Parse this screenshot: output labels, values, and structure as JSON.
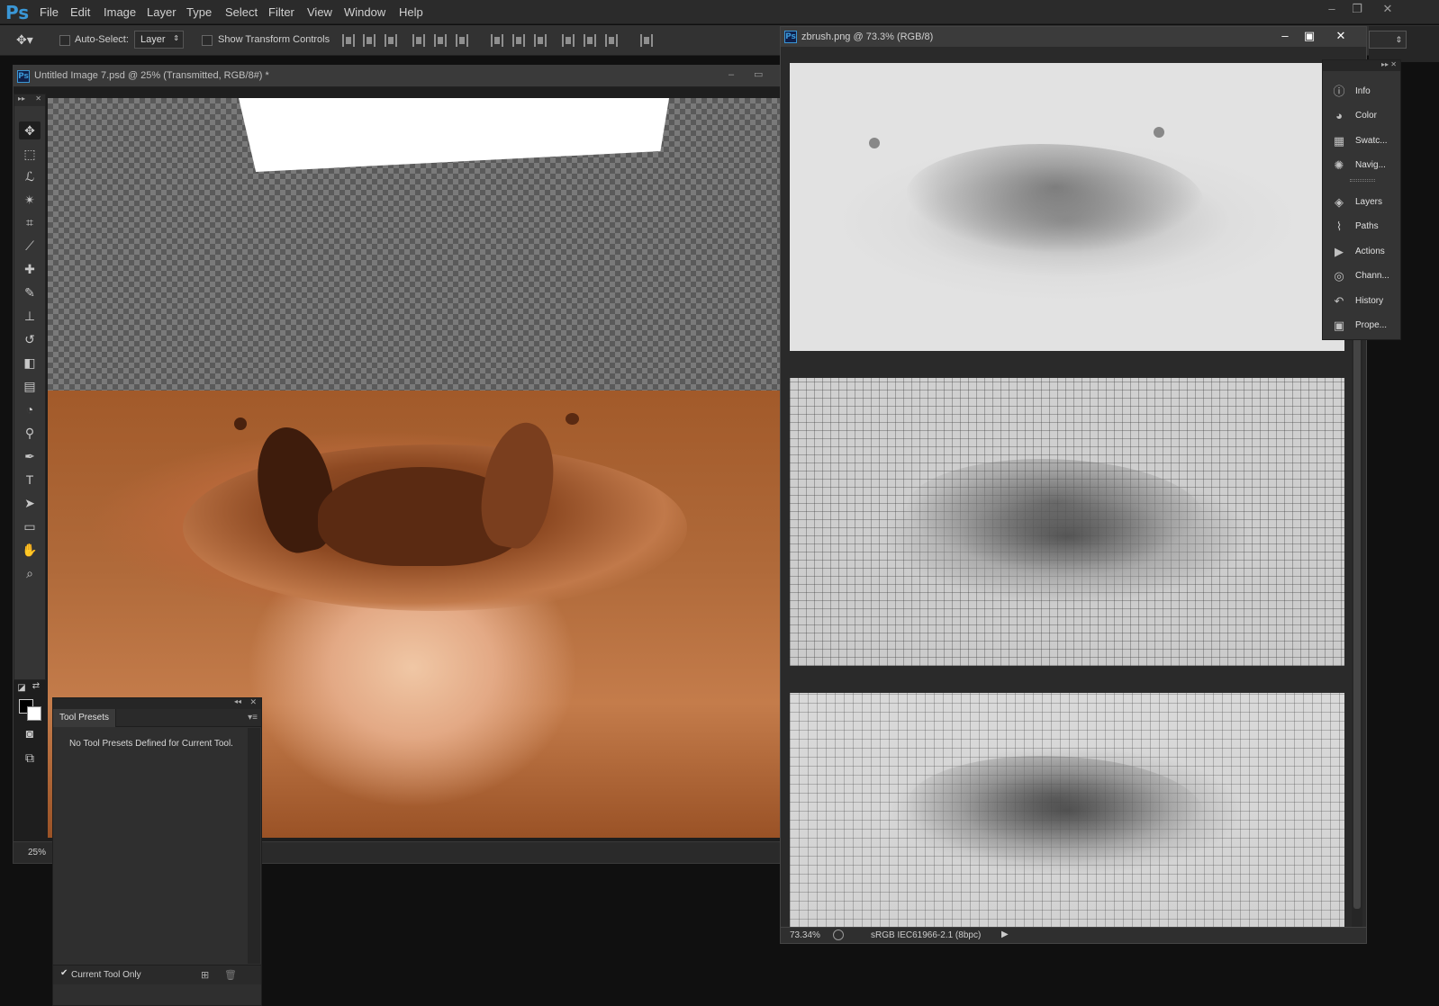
{
  "app": {
    "logo": "Ps"
  },
  "menu": [
    "File",
    "Edit",
    "Image",
    "Layer",
    "Type",
    "Select",
    "Filter",
    "View",
    "Window",
    "Help"
  ],
  "window_buttons": {
    "minimize": "–",
    "restore": "❐",
    "close": "✕"
  },
  "options": {
    "auto_select_label": "Auto-Select:",
    "auto_select_value": "Layer",
    "show_transform_label": "Show Transform Controls"
  },
  "left_doc": {
    "title": "Untitled Image 7.psd @ 25% (Transmitted, RGB/8#) *",
    "zoom": "25%"
  },
  "tools": [
    {
      "icon": "move-icon",
      "glyph": "✥"
    },
    {
      "icon": "marquee-icon",
      "glyph": "⬚"
    },
    {
      "icon": "lasso-icon",
      "glyph": "ℒ"
    },
    {
      "icon": "magic-wand-icon",
      "glyph": "✴"
    },
    {
      "icon": "crop-icon",
      "glyph": "⌗"
    },
    {
      "icon": "eyedropper-icon",
      "glyph": "⟋"
    },
    {
      "icon": "healing-brush-icon",
      "glyph": "✚"
    },
    {
      "icon": "brush-icon",
      "glyph": "✎"
    },
    {
      "icon": "clone-stamp-icon",
      "glyph": "⊥"
    },
    {
      "icon": "history-brush-icon",
      "glyph": "↺"
    },
    {
      "icon": "eraser-icon",
      "glyph": "◧"
    },
    {
      "icon": "gradient-icon",
      "glyph": "▤"
    },
    {
      "icon": "blur-icon",
      "glyph": "◔"
    },
    {
      "icon": "dodge-icon",
      "glyph": "⚲"
    },
    {
      "icon": "pen-icon",
      "glyph": "✒"
    },
    {
      "icon": "type-icon",
      "glyph": "T"
    },
    {
      "icon": "path-selection-icon",
      "glyph": "➤"
    },
    {
      "icon": "rectangle-icon",
      "glyph": "▭"
    },
    {
      "icon": "hand-icon",
      "glyph": "✋"
    },
    {
      "icon": "zoom-icon",
      "glyph": "⌕"
    }
  ],
  "tool_presets": {
    "tab": "Tool Presets",
    "message": "No Tool Presets Defined for Current Tool.",
    "footer_label": "Current Tool Only"
  },
  "right_doc": {
    "title": "zbrush.png @ 73.3% (RGB/8)",
    "zoom": "73.34%",
    "profile": "sRGB IEC61966-2.1 (8bpc)"
  },
  "dock": [
    {
      "label": "Info",
      "icon": "info-icon",
      "glyph": "ⓘ"
    },
    {
      "label": "Color",
      "icon": "color-icon",
      "glyph": "◕"
    },
    {
      "label": "Swatc...",
      "icon": "swatches-icon",
      "glyph": "▦"
    },
    {
      "label": "Navig...",
      "icon": "navigator-icon",
      "glyph": "✺"
    },
    {
      "label": "Layers",
      "icon": "layers-icon",
      "glyph": "◈"
    },
    {
      "label": "Paths",
      "icon": "paths-icon",
      "glyph": "⌇"
    },
    {
      "label": "Actions",
      "icon": "actions-icon",
      "glyph": "▶"
    },
    {
      "label": "Chann...",
      "icon": "channels-icon",
      "glyph": "◎"
    },
    {
      "label": "History",
      "icon": "history-icon",
      "glyph": "↶"
    },
    {
      "label": "Prope...",
      "icon": "properties-icon",
      "glyph": "▣"
    }
  ],
  "colors": {
    "accent": "#3a97d6",
    "chocolate": "#b06a3a",
    "background": "#101010"
  }
}
